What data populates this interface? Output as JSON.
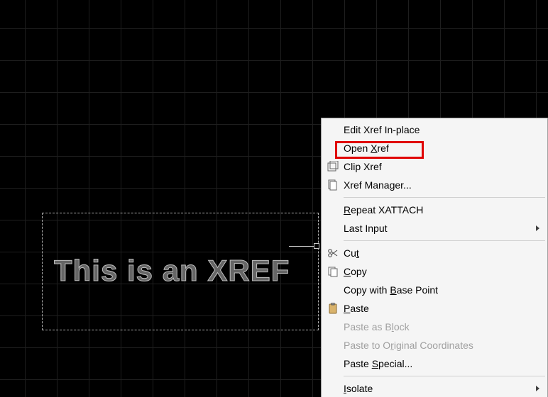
{
  "canvas": {
    "xref_text": "This is an XREF"
  },
  "menu": {
    "groups": [
      {
        "items": [
          {
            "id": "edit-xref-in-place",
            "label": "Edit Xref In-place",
            "icon": null,
            "enabled": true,
            "submenu": false,
            "highlight": false
          },
          {
            "id": "open-xref",
            "label": "Open Xref",
            "accel_index": 5,
            "icon": null,
            "enabled": true,
            "submenu": false,
            "highlight": true
          },
          {
            "id": "clip-xref",
            "label": "Clip Xref",
            "icon": "clip-icon",
            "enabled": true,
            "submenu": false
          },
          {
            "id": "xref-manager",
            "label": "Xref Manager...",
            "icon": "xref-manager-icon",
            "enabled": true,
            "submenu": false
          }
        ]
      },
      {
        "items": [
          {
            "id": "repeat-xattach",
            "label": "Repeat XATTACH",
            "accel_index": 0,
            "enabled": true
          },
          {
            "id": "last-input",
            "label": "Last Input",
            "enabled": true,
            "submenu": true
          }
        ]
      },
      {
        "items": [
          {
            "id": "cut",
            "label": "Cut",
            "accel_index": 2,
            "icon": "scissors-icon",
            "enabled": true
          },
          {
            "id": "copy",
            "label": "Copy",
            "accel_index": 0,
            "icon": "copy-icon",
            "enabled": true
          },
          {
            "id": "copy-with-base-point",
            "label": "Copy with Base Point",
            "accel_index": 10,
            "enabled": true
          },
          {
            "id": "paste",
            "label": "Paste",
            "accel_index": 0,
            "icon": "paste-icon",
            "enabled": true
          },
          {
            "id": "paste-as-block",
            "label": "Paste as Block",
            "accel_index": 10,
            "enabled": false
          },
          {
            "id": "paste-to-original",
            "label": "Paste to Original Coordinates",
            "accel_index": 10,
            "enabled": false
          },
          {
            "id": "paste-special",
            "label": "Paste Special...",
            "accel_index": 6,
            "enabled": true
          }
        ]
      },
      {
        "items": [
          {
            "id": "isolate",
            "label": "Isolate",
            "accel_index": 0,
            "enabled": true,
            "submenu": true
          }
        ]
      }
    ]
  },
  "colors": {
    "highlight": "#e00000",
    "grid_line": "#1e1e1e",
    "menu_bg": "#f5f5f5"
  }
}
